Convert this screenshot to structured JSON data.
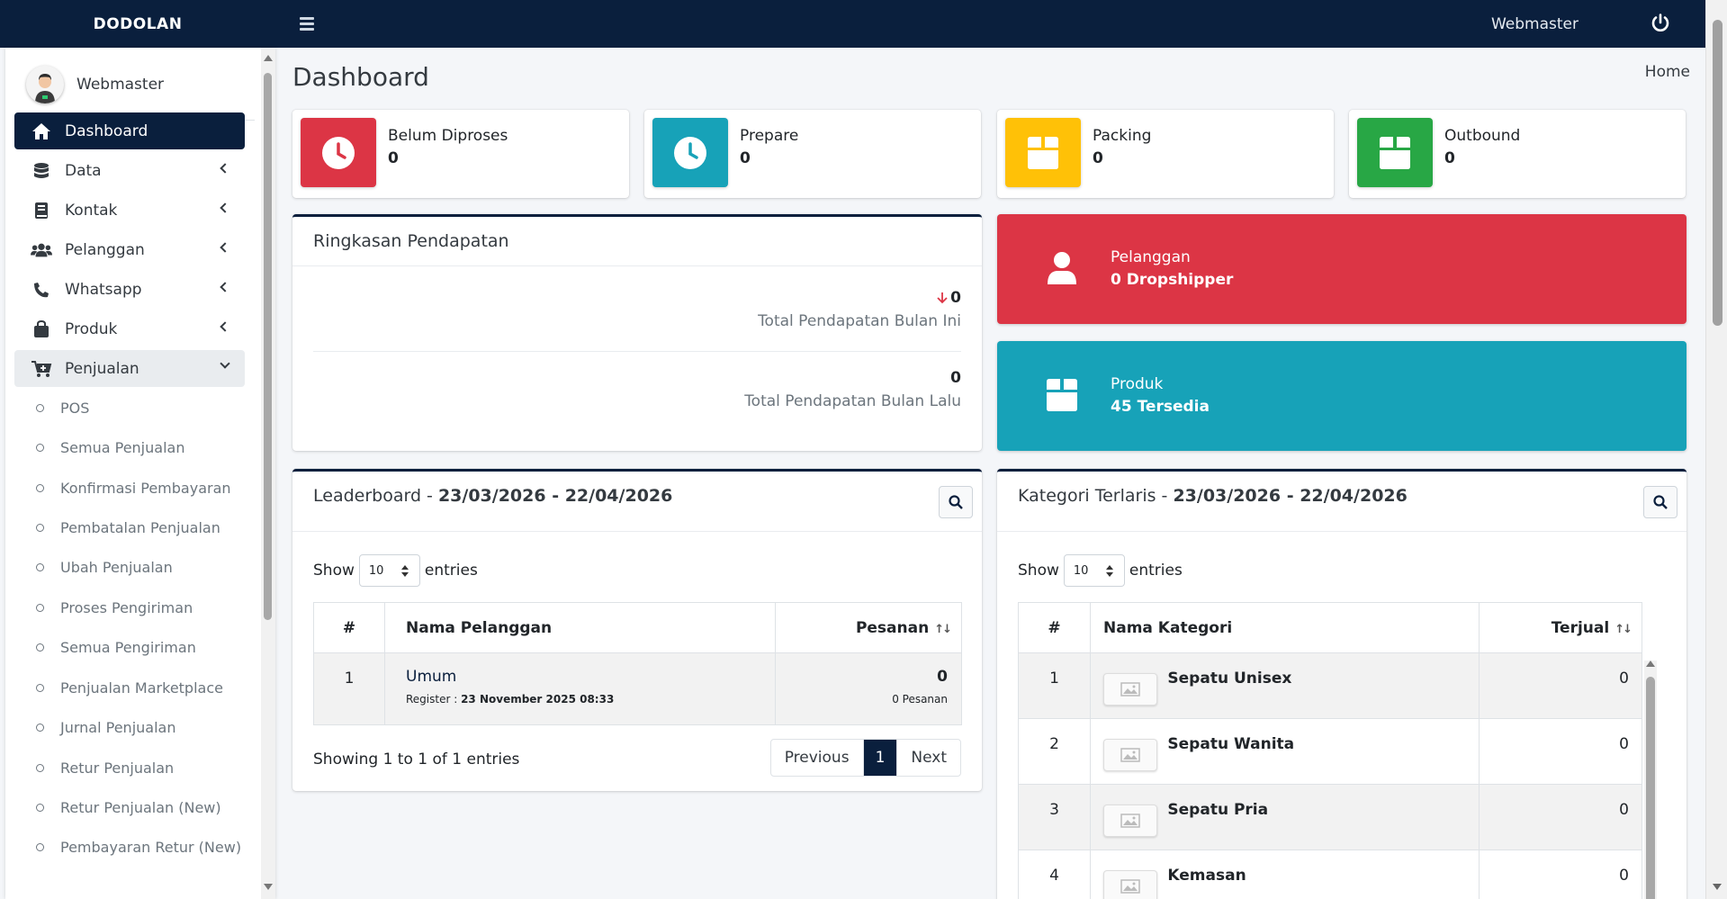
{
  "brand": "DODOLAN",
  "topbar": {
    "user": "Webmaster"
  },
  "sidebar": {
    "user_name": "Webmaster",
    "menu": [
      {
        "label": "Dashboard",
        "icon": "home-icon"
      },
      {
        "label": "Data",
        "icon": "database-icon"
      },
      {
        "label": "Kontak",
        "icon": "book-icon"
      },
      {
        "label": "Pelanggan",
        "icon": "users-icon"
      },
      {
        "label": "Whatsapp",
        "icon": "phone-icon"
      },
      {
        "label": "Produk",
        "icon": "shopping-bag-icon"
      },
      {
        "label": "Penjualan",
        "icon": "cart-plus-icon"
      }
    ],
    "submenu": [
      "POS",
      "Semua Penjualan",
      "Konfirmasi Pembayaran",
      "Pembatalan Penjualan",
      "Ubah Penjualan",
      "Proses Pengiriman",
      "Semua Pengiriman",
      "Penjualan Marketplace",
      "Jurnal Penjualan",
      "Retur Penjualan",
      "Retur Penjualan (New)",
      "Pembayaran Retur (New)"
    ]
  },
  "page": {
    "title": "Dashboard",
    "breadcrumb": "Home"
  },
  "status_boxes": [
    {
      "label": "Belum Diproses",
      "value": "0",
      "color": "#dc3545",
      "icon": "clock-icon"
    },
    {
      "label": "Prepare",
      "value": "0",
      "color": "#17a2b8",
      "icon": "clock-icon"
    },
    {
      "label": "Packing",
      "value": "0",
      "color": "#ffc107",
      "icon": "box-icon"
    },
    {
      "label": "Outbound",
      "value": "0",
      "color": "#28a745",
      "icon": "box-icon"
    }
  ],
  "revenue": {
    "title": "Ringkasan Pendapatan",
    "this_month_value": "0",
    "this_month_label": "Total Pendapatan Bulan Ini",
    "last_month_value": "0",
    "last_month_label": "Total Pendapatan Bulan Lalu"
  },
  "summary_boxes": [
    {
      "label": "Pelanggan",
      "value": "0 Dropshipper",
      "color": "#dc3545",
      "icon": "user-icon"
    },
    {
      "label": "Produk",
      "value": "45 Tersedia",
      "color": "#17a2b8",
      "icon": "box-icon"
    }
  ],
  "leaderboard": {
    "title": "Leaderboard",
    "separator": " - ",
    "range": "23/03/2026 - 22/04/2026",
    "show": "Show",
    "length": "10",
    "entries": "entries",
    "columns": [
      "#",
      "Nama Pelanggan",
      "Pesanan"
    ],
    "rows": [
      {
        "no": "1",
        "name": "Umum",
        "register_label": "Register : ",
        "register_date": "23 November 2025 08:33",
        "orders": "0",
        "orders_label": "0 Pesanan"
      }
    ],
    "info": "Showing 1 to 1 of 1 entries",
    "pager": {
      "prev": "Previous",
      "page": "1",
      "next": "Next"
    }
  },
  "kategori": {
    "title": "Kategori Terlaris",
    "separator": " - ",
    "range": "23/03/2026 - 22/04/2026",
    "show": "Show",
    "length": "10",
    "entries": "entries",
    "columns": [
      "#",
      "Nama Kategori",
      "Terjual"
    ],
    "rows": [
      {
        "no": "1",
        "name": "Sepatu Unisex",
        "sold": "0"
      },
      {
        "no": "2",
        "name": "Sepatu Wanita",
        "sold": "0"
      },
      {
        "no": "3",
        "name": "Sepatu Pria",
        "sold": "0"
      },
      {
        "no": "4",
        "name": "Kemasan",
        "sold": "0"
      }
    ]
  }
}
